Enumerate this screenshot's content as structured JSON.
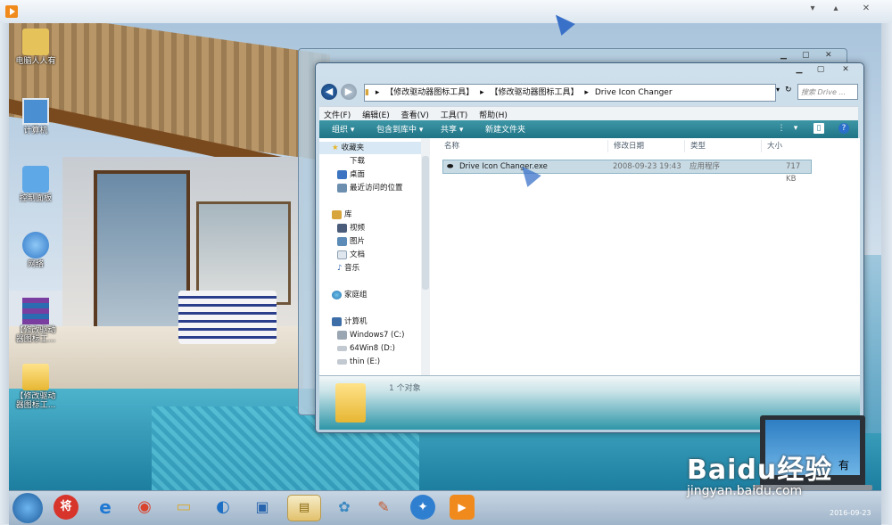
{
  "desktop": {
    "icons": [
      {
        "label": "电脑人人有",
        "icon": "user-folder-icon",
        "color": "#e6c35a"
      },
      {
        "label": "计算机",
        "icon": "computer-icon",
        "color": "#4b8fd3"
      },
      {
        "label": "控制面板",
        "icon": "control-panel-icon",
        "color": "#5fa8e8"
      },
      {
        "label": "网络",
        "icon": "network-icon",
        "color": "#2f77c8"
      },
      {
        "label": "【修改驱动器图标工...",
        "icon": "winrar-archive-icon",
        "color": "#7a3ea0"
      },
      {
        "label": "【修改驱动器图标工...",
        "icon": "folder-icon",
        "color": "#f0c851"
      }
    ]
  },
  "explorer": {
    "address": [
      "【修改驱动器图标工具】",
      "【修改驱动器图标工具】",
      "Drive Icon Changer"
    ],
    "search_placeholder": "搜索 Drive ...",
    "menu": [
      "文件(F)",
      "编辑(E)",
      "查看(V)",
      "工具(T)",
      "帮助(H)"
    ],
    "commands": [
      "组织 ▾",
      "包含到库中 ▾",
      "共享 ▾",
      "新建文件夹"
    ],
    "nav": {
      "favorites": "收藏夹",
      "favorites_items": [
        "下载",
        "桌面",
        "最近访问的位置"
      ],
      "libraries": "库",
      "library_items": [
        "视频",
        "图片",
        "文档",
        "音乐"
      ],
      "homegroup": "家庭组",
      "computer": "计算机",
      "drives": [
        "Windows7 (C:)",
        "64Win8 (D:)",
        "thin (E:)"
      ]
    },
    "columns": [
      "名称",
      "修改日期",
      "类型",
      "大小"
    ],
    "file": {
      "name": "Drive Icon Changer.exe",
      "date": "2008-09-23 19:43",
      "type": "应用程序",
      "size": "717 KB"
    },
    "status": "1 个对象"
  },
  "taskbar": {
    "items": [
      {
        "icon": "start-orb-icon"
      },
      {
        "icon": "app-red-icon",
        "glyph": "将"
      },
      {
        "icon": "ie-icon",
        "glyph": "e"
      },
      {
        "icon": "chrome-icon",
        "glyph": "◉"
      },
      {
        "icon": "folder-yellow-icon",
        "glyph": "▭"
      },
      {
        "icon": "browser-blue-icon",
        "glyph": "◐"
      },
      {
        "icon": "remote-icon",
        "glyph": "▣"
      },
      {
        "icon": "explorer-icon",
        "glyph": "▤"
      },
      {
        "icon": "fan-icon",
        "glyph": "✿"
      },
      {
        "icon": "paint-icon",
        "glyph": "✎"
      },
      {
        "icon": "settings-blue-icon",
        "glyph": "✦"
      },
      {
        "icon": "media-player-icon",
        "glyph": "▶"
      }
    ],
    "clock_date": "2016-09-23"
  },
  "watermark": {
    "brand": "Baidu经验",
    "url": "jingyan.baidu.com",
    "screen_text": "有"
  }
}
